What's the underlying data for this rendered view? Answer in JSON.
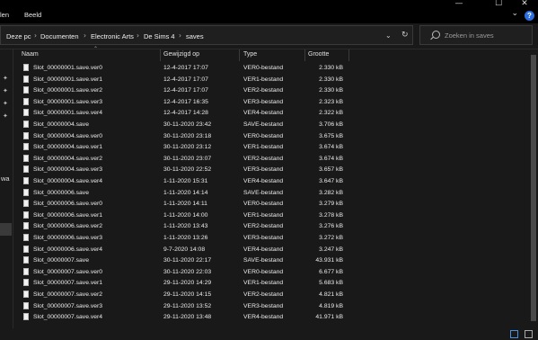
{
  "ribbon": {
    "partial_tab": "len",
    "tab_view": "Beeld",
    "minimize_glyph": "—",
    "maximize_glyph": "☐",
    "close_glyph": "✕",
    "help_glyph": "?"
  },
  "address": {
    "crumbs": [
      "Deze pc",
      "Documenten",
      "Electronic Arts",
      "De Sims 4",
      "saves"
    ],
    "separator": "›"
  },
  "search": {
    "placeholder": "Zoeken in saves"
  },
  "nav": {
    "partial_label": "wa"
  },
  "columns": {
    "name": "Naam",
    "date": "Gewijzigd op",
    "type": "Type",
    "size": "Grootte"
  },
  "files": [
    {
      "name": "Slot_00000001.save.ver0",
      "date": "12-4-2017 17:07",
      "type": "VER0-bestand",
      "size": "2.330 kB"
    },
    {
      "name": "Slot_00000001.save.ver1",
      "date": "12-4-2017 17:07",
      "type": "VER1-bestand",
      "size": "2.330 kB"
    },
    {
      "name": "Slot_00000001.save.ver2",
      "date": "12-4-2017 17:07",
      "type": "VER2-bestand",
      "size": "2.330 kB"
    },
    {
      "name": "Slot_00000001.save.ver3",
      "date": "12-4-2017 16:35",
      "type": "VER3-bestand",
      "size": "2.323 kB"
    },
    {
      "name": "Slot_00000001.save.ver4",
      "date": "12-4-2017 14:28",
      "type": "VER4-bestand",
      "size": "2.322 kB"
    },
    {
      "name": "Slot_00000004.save",
      "date": "30-11-2020 23:42",
      "type": "SAVE-bestand",
      "size": "3.706 kB"
    },
    {
      "name": "Slot_00000004.save.ver0",
      "date": "30-11-2020 23:18",
      "type": "VER0-bestand",
      "size": "3.675 kB"
    },
    {
      "name": "Slot_00000004.save.ver1",
      "date": "30-11-2020 23:12",
      "type": "VER1-bestand",
      "size": "3.674 kB"
    },
    {
      "name": "Slot_00000004.save.ver2",
      "date": "30-11-2020 23:07",
      "type": "VER2-bestand",
      "size": "3.674 kB"
    },
    {
      "name": "Slot_00000004.save.ver3",
      "date": "30-11-2020 22:52",
      "type": "VER3-bestand",
      "size": "3.657 kB"
    },
    {
      "name": "Slot_00000004.save.ver4",
      "date": "1-11-2020 15:31",
      "type": "VER4-bestand",
      "size": "3.647 kB"
    },
    {
      "name": "Slot_00000006.save",
      "date": "1-11-2020 14:14",
      "type": "SAVE-bestand",
      "size": "3.282 kB"
    },
    {
      "name": "Slot_00000006.save.ver0",
      "date": "1-11-2020 14:11",
      "type": "VER0-bestand",
      "size": "3.279 kB"
    },
    {
      "name": "Slot_00000006.save.ver1",
      "date": "1-11-2020 14:00",
      "type": "VER1-bestand",
      "size": "3.278 kB"
    },
    {
      "name": "Slot_00000006.save.ver2",
      "date": "1-11-2020 13:43",
      "type": "VER2-bestand",
      "size": "3.276 kB"
    },
    {
      "name": "Slot_00000006.save.ver3",
      "date": "1-11-2020 13:26",
      "type": "VER3-bestand",
      "size": "3.272 kB"
    },
    {
      "name": "Slot_00000006.save.ver4",
      "date": "9-7-2020 14:08",
      "type": "VER4-bestand",
      "size": "3.247 kB"
    },
    {
      "name": "Slot_00000007.save",
      "date": "30-11-2020 22:17",
      "type": "SAVE-bestand",
      "size": "43.931 kB"
    },
    {
      "name": "Slot_00000007.save.ver0",
      "date": "30-11-2020 22:03",
      "type": "VER0-bestand",
      "size": "6.677 kB"
    },
    {
      "name": "Slot_00000007.save.ver1",
      "date": "29-11-2020 14:29",
      "type": "VER1-bestand",
      "size": "5.683 kB"
    },
    {
      "name": "Slot_00000007.save.ver2",
      "date": "29-11-2020 14:15",
      "type": "VER2-bestand",
      "size": "4.821 kB"
    },
    {
      "name": "Slot_00000007.save.ver3",
      "date": "29-11-2020 13:52",
      "type": "VER3-bestand",
      "size": "4.819 kB"
    },
    {
      "name": "Slot_00000007.save.ver4",
      "date": "29-11-2020 13:48",
      "type": "VER4-bestand",
      "size": "41.971 kB"
    }
  ],
  "icons": {
    "file": "document-icon",
    "search": "search-icon",
    "pin": "pin-icon",
    "refresh": "refresh-icon",
    "dropdown": "chevron-down-icon"
  },
  "colors": {
    "background": "#191919",
    "titlebar": "#000000",
    "text": "#ececec",
    "accent": "#2b6ee0"
  }
}
